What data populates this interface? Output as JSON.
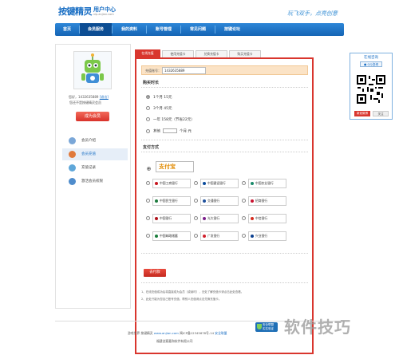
{
  "header": {
    "logo": "按键精灵",
    "logo_sub": "用户中心",
    "logo_url": "vip.anjian.com",
    "slogan": "玩飞双手，点亮创意"
  },
  "nav": [
    "首页",
    "会员服务",
    "我的资料",
    "账号管理",
    "常见问题",
    "按键论坛"
  ],
  "user": {
    "id_label": "您好，1432635889",
    "exit_link": "[退出]",
    "status": "您还不是按键精灵会员",
    "become_button": "成为会员"
  },
  "side_menu": [
    {
      "label": "会员介绍",
      "color": "#7aa7d8"
    },
    {
      "label": "会员充值",
      "color": "#e07a3c"
    },
    {
      "label": "充值记录",
      "color": "#5fa7d9"
    },
    {
      "label": "激活会员权限",
      "color": "#4f8ccc"
    }
  ],
  "tabs": [
    "在线充值",
    "使用充值卡",
    "兑换充值卡",
    "购买充值卡"
  ],
  "recharge": {
    "account_label": "充值账号：",
    "account_value": "1432635889",
    "duration_title": "购买时长",
    "options": [
      {
        "label": "1个月  15元",
        "selected": true
      },
      {
        "label": "3个月  45元",
        "selected": false
      },
      {
        "label": "一年  158元（节省22元）",
        "selected": false
      },
      {
        "label_prefix": "其他",
        "label_suffix": "个月  元",
        "selected": false
      }
    ],
    "payment_title": "支付方式",
    "alipay": "支付宝",
    "banks": [
      [
        "中国工商银行",
        "中国建设银行",
        "中国农业银行"
      ],
      [
        "中国民生银行",
        "交通银行",
        "招商银行"
      ],
      [
        "中国银行",
        "光大银行",
        "中信银行"
      ],
      [
        "中国邮政储蓄",
        "广发银行",
        "兴业银行"
      ]
    ],
    "pay_button": "去付款",
    "notes": [
      "1、在线充值成功后将直接成为会员（或续时），无处了解充值卡请点击此处查看。",
      "2、此处只能为您自己账号充值，帮别人充值请点击兑换充值卡。"
    ]
  },
  "right_panel": {
    "title": "在线咨询",
    "qq_button": "QQ咨询",
    "btn_weibo": "新浪微博",
    "btn_follow": "关注"
  },
  "footer": {
    "line1_prefix": "游戏世界   按键精灵   ",
    "line1_link": "www.anjian.com",
    "line1_suffix": "   闽ICP备12345678号-14",
    "line1_link2": "安全联盟",
    "line2": "福建创意嘉和软件有限公司",
    "trust_badge": "安全联盟 实名验证"
  },
  "watermark": "软件技巧"
}
